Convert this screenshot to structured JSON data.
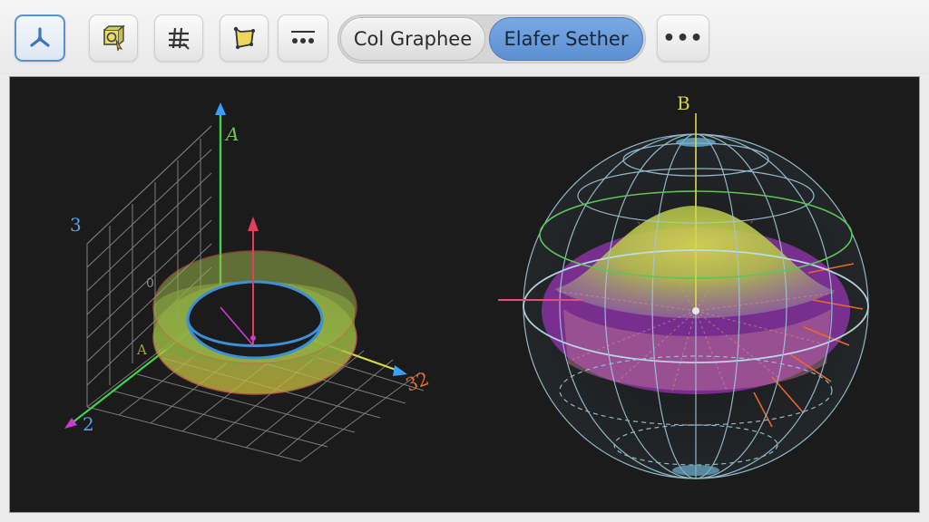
{
  "toolbar": {
    "tools": [
      {
        "name": "axes-tool",
        "icon": "axes-icon",
        "active": true
      },
      {
        "name": "select-object-tool",
        "icon": "select-object-icon",
        "active": false
      },
      {
        "name": "grid-tool",
        "icon": "grid-icon",
        "active": false
      },
      {
        "name": "surface-tool",
        "icon": "surface-icon",
        "active": false
      },
      {
        "name": "options-tool",
        "icon": "dots-line-icon",
        "active": false
      }
    ],
    "view_toggle": {
      "left_label": "Col Graphee",
      "right_label": "Elafer Sether",
      "selected": "Elafer Sether"
    },
    "more_label": "•••"
  },
  "left_view": {
    "axis_top_label": "A",
    "axis_left_label": "3",
    "axis_bottom_label": "2",
    "axis_right_label": "32",
    "small_label_a": "A",
    "small_label_zero": "0"
  },
  "right_view": {
    "axis_top_label": "B"
  },
  "colors": {
    "accent": "#5d90d2",
    "viewport_bg": "#1b1b1c",
    "grid": "#8a8a8a",
    "axis_green": "#3fd44b",
    "axis_blue": "#3aa0ff",
    "axis_magenta": "#c83cd0",
    "axis_red": "#e0405a",
    "torus_green": "#8ec23f",
    "torus_inner_blue": "#3d8fd6",
    "sphere_wire": "#9fc8d8",
    "surface_purple": "#a43cc0",
    "surface_yellow": "#cfd64a"
  }
}
